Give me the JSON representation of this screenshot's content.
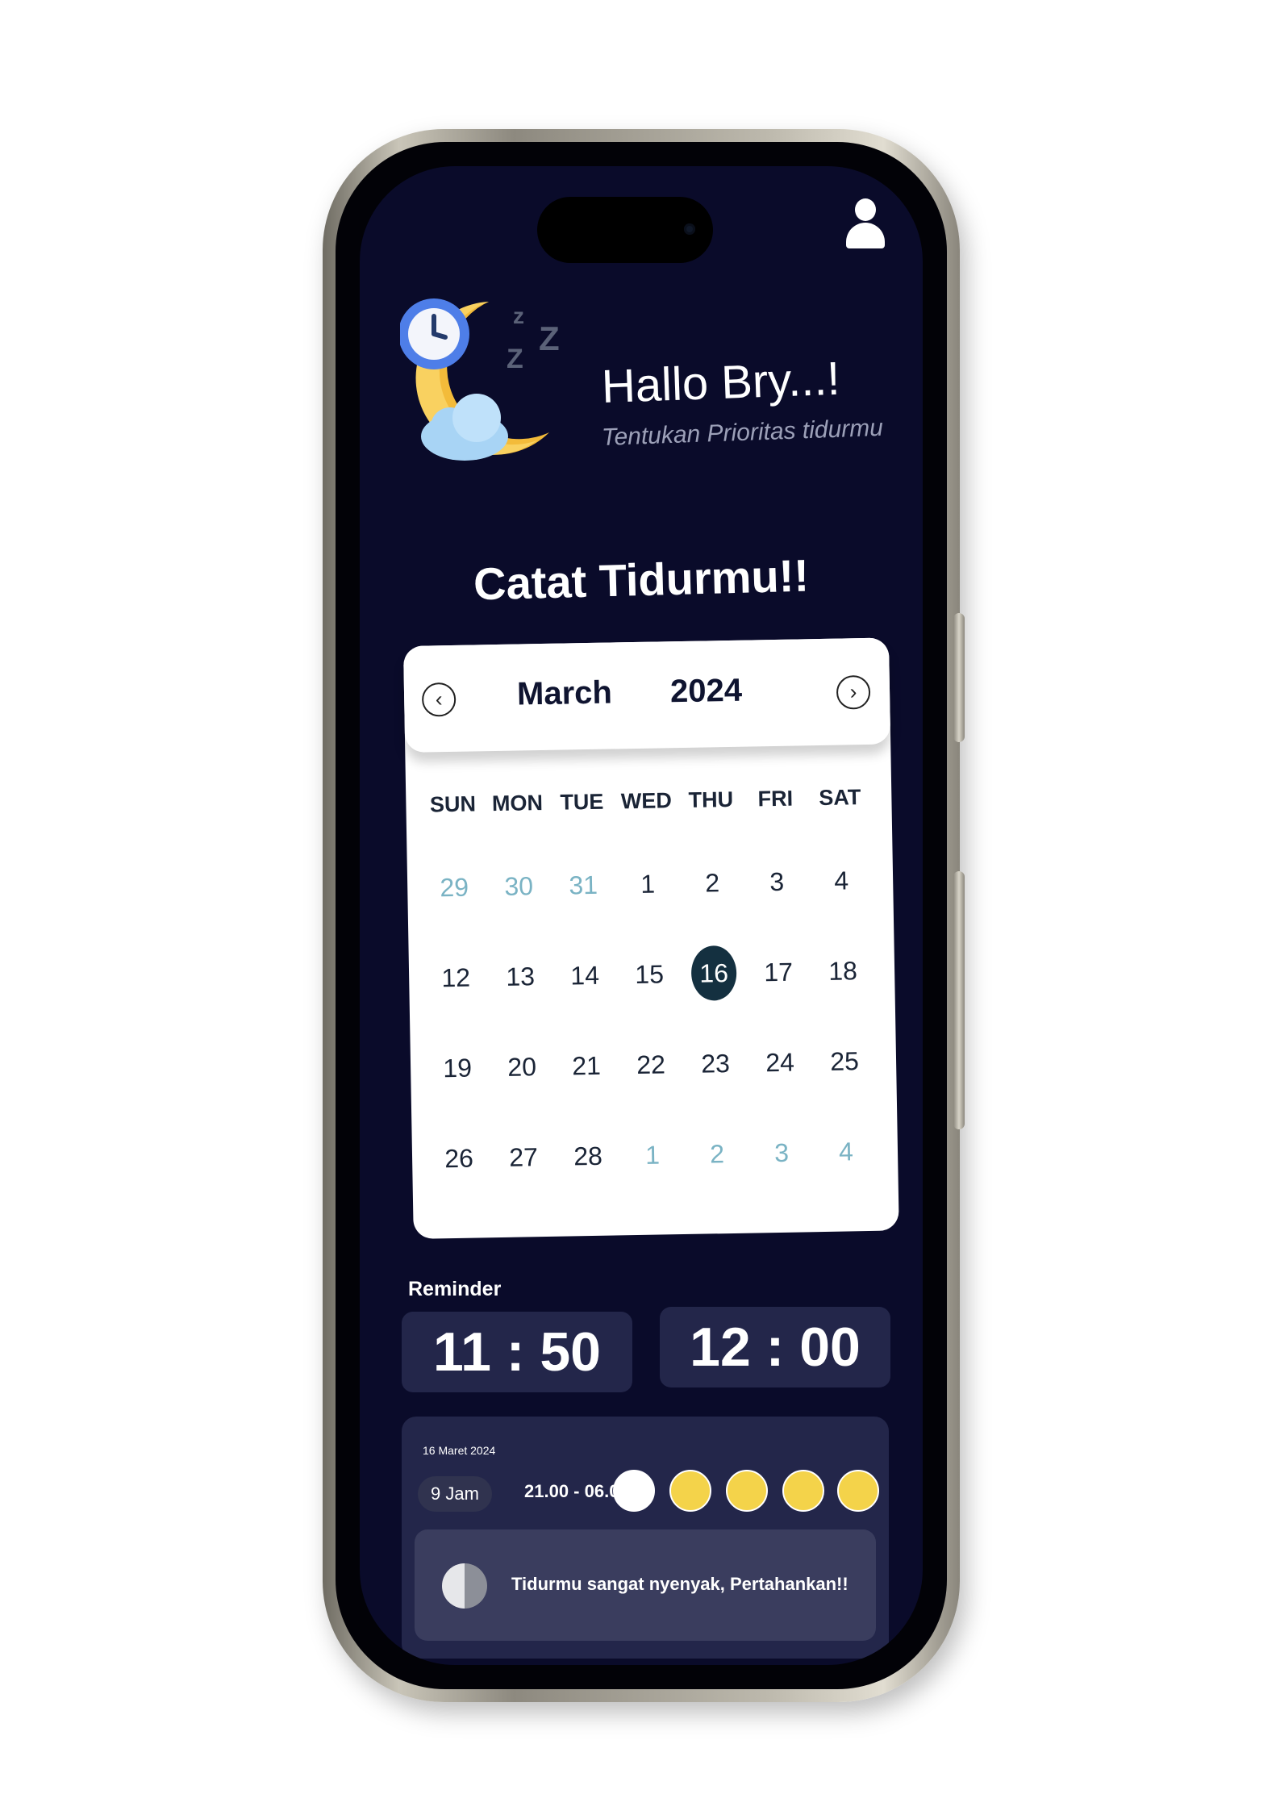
{
  "header": {
    "greeting": "Hallo Bry...!",
    "subtitle": "Tentukan Prioritas tidurmu",
    "profile_icon": "user-icon"
  },
  "main": {
    "title": "Catat Tidurmu!!"
  },
  "calendar": {
    "month": "March",
    "year": "2024",
    "prev_icon": "chevron-left-icon",
    "next_icon": "chevron-right-icon",
    "weekdays": [
      "SUN",
      "MON",
      "TUE",
      "WED",
      "THU",
      "FRI",
      "SAT"
    ],
    "weeks": [
      [
        {
          "d": "29",
          "m": true
        },
        {
          "d": "30",
          "m": true
        },
        {
          "d": "31",
          "m": true
        },
        {
          "d": "1"
        },
        {
          "d": "2"
        },
        {
          "d": "3"
        },
        {
          "d": "4"
        }
      ],
      [
        {
          "d": "12"
        },
        {
          "d": "13"
        },
        {
          "d": "14"
        },
        {
          "d": "15"
        },
        {
          "d": "16",
          "sel": true
        },
        {
          "d": "17"
        },
        {
          "d": "18"
        }
      ],
      [
        {
          "d": "19"
        },
        {
          "d": "20"
        },
        {
          "d": "21"
        },
        {
          "d": "22"
        },
        {
          "d": "23"
        },
        {
          "d": "24"
        },
        {
          "d": "25"
        }
      ],
      [
        {
          "d": "26"
        },
        {
          "d": "27"
        },
        {
          "d": "28"
        },
        {
          "d": "1",
          "m": true
        },
        {
          "d": "2",
          "m": true
        },
        {
          "d": "3",
          "m": true
        },
        {
          "d": "4",
          "m": true
        }
      ]
    ],
    "selected_day": "16"
  },
  "reminder": {
    "label": "Reminder",
    "time_1": "11 : 50",
    "time_2": "12 : 00"
  },
  "history": {
    "date": "16 Maret 2024",
    "duration": "9 Jam",
    "range": "21.00 - 06.00",
    "mood_icons": [
      "sleeping-mood-icon",
      "injured-mood-icon",
      "sick-mood-icon",
      "sad-mood-icon",
      "tired-mood-icon"
    ],
    "message": "Tidurmu sangat nyenyak, Pertahankan!!"
  },
  "bottom_nav": {
    "items": [
      "home-icon",
      "add-icon",
      "stats-icon"
    ]
  },
  "colors": {
    "background": "#0a0b2a",
    "card": "#23264a",
    "selected_day": "#143040",
    "muted_day": "#7ab3c4"
  }
}
